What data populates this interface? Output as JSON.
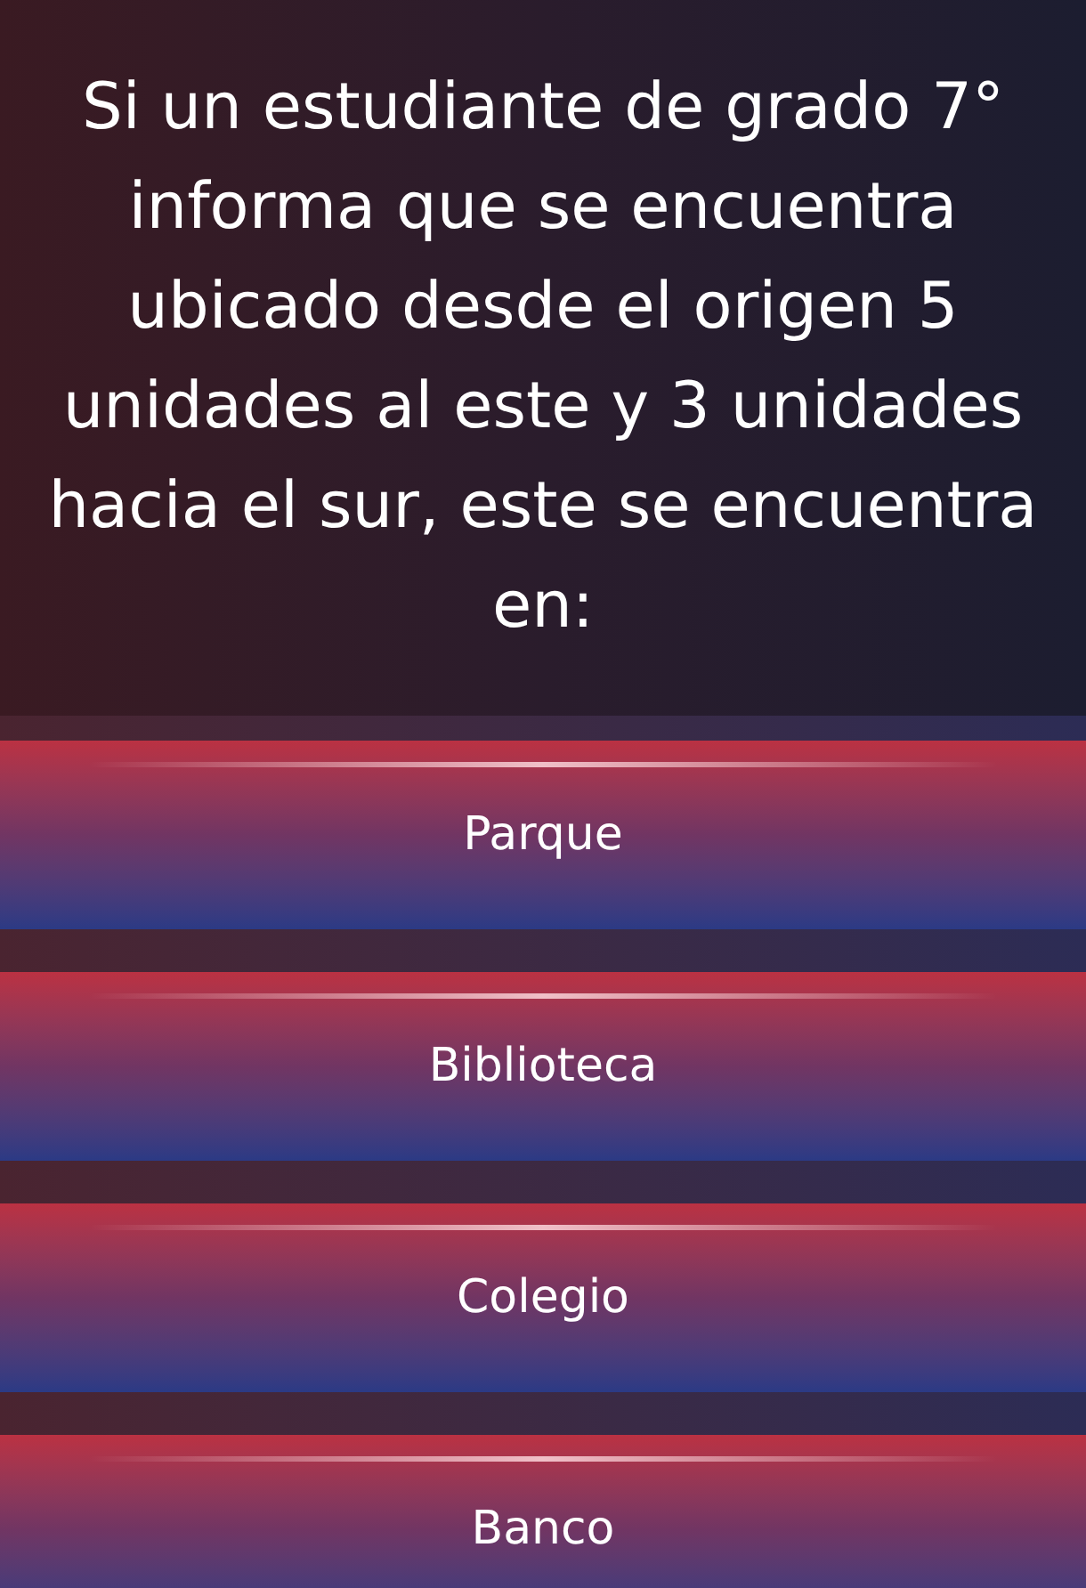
{
  "question": "Si un estudiante de grado 7° informa que se encuentra ubicado desde el origen 5 unidades al este y 3 unidades hacia el sur, este se encuentra en:",
  "answers": [
    {
      "label": "Parque"
    },
    {
      "label": "Biblioteca"
    },
    {
      "label": "Colegio"
    },
    {
      "label": "Banco"
    }
  ]
}
